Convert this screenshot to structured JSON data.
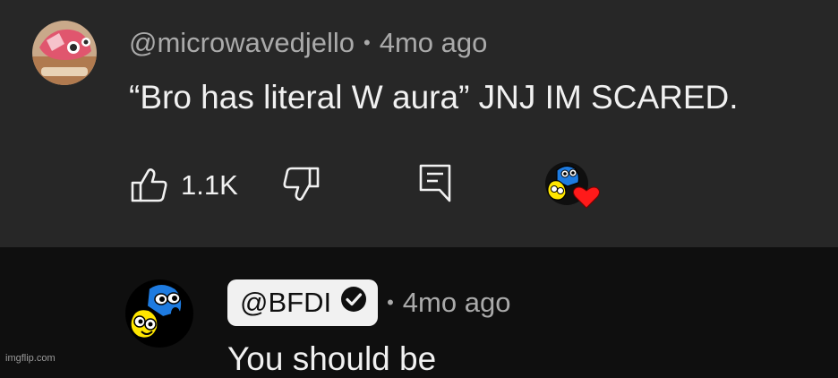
{
  "comment": {
    "author": "@microwavedjello",
    "separator": "•",
    "time": "4mo ago",
    "text": "“Bro has literal W aura” JNJ IM SCARED.",
    "like_count": "1.1K",
    "icons": {
      "like": "thumbs-up-icon",
      "dislike": "thumbs-down-icon",
      "reply": "reply-icon",
      "creator_heart": "creator-heart-icon"
    }
  },
  "reply": {
    "author": "@BFDI",
    "separator": "•",
    "time": "4mo ago",
    "text": "You should be",
    "verified_icon": "verified-check-icon"
  },
  "watermark": "imgflip.com",
  "colors": {
    "comment_bg": "#272727",
    "reply_bg": "#0f0f0f",
    "text": "#f1f1f1",
    "meta": "#aaaaaa",
    "heart": "#ff1a1a",
    "bfdi_blue": "#1e7be0",
    "bfdi_yellow": "#ffe600"
  }
}
